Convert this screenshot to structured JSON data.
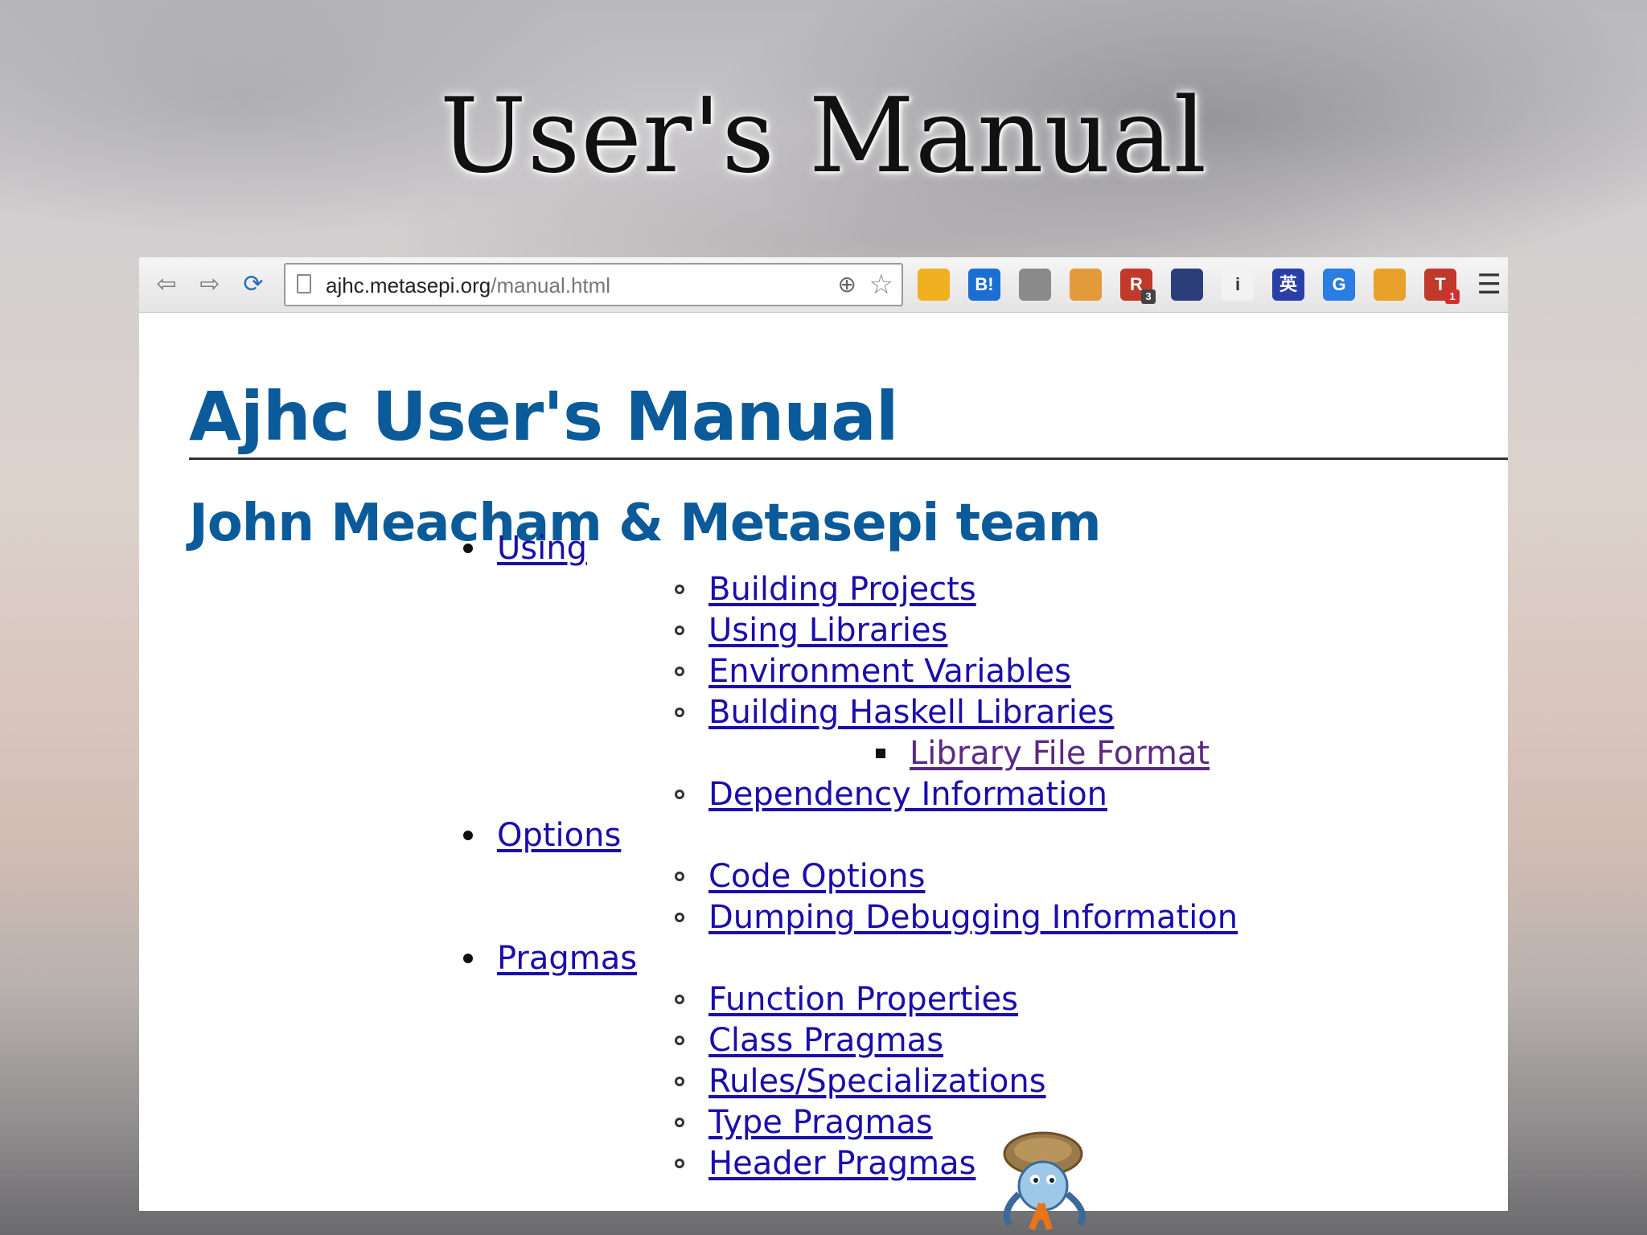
{
  "slide": {
    "title": "User's Manual"
  },
  "browser": {
    "url_host": "ajhc.metasepi.org",
    "url_path": "/manual.html",
    "nav": {
      "back_icon": "back-arrow-icon",
      "forward_icon": "forward-arrow-icon",
      "reload_icon": "reload-icon"
    },
    "extensions": [
      {
        "name": "ext-sync-icon",
        "label": "",
        "color": "#f0b020"
      },
      {
        "name": "ext-hatena-bookmark-icon",
        "label": "B!",
        "color": "#1b6fd3"
      },
      {
        "name": "ext-mail-icon",
        "label": "",
        "color": "#8a8a8a"
      },
      {
        "name": "ext-fox-icon",
        "label": "",
        "color": "#e39a3a"
      },
      {
        "name": "ext-r-icon",
        "label": "R",
        "color": "#c0392b",
        "badge": "3"
      },
      {
        "name": "ext-night-icon",
        "label": "",
        "color": "#2c3e7a"
      },
      {
        "name": "ext-info-icon",
        "label": "i",
        "color": "#f2f2f2"
      },
      {
        "name": "ext-eiji-icon",
        "label": "英",
        "color": "#2b3fa8"
      },
      {
        "name": "ext-google-icon",
        "label": "G",
        "color": "#2a7de1"
      },
      {
        "name": "ext-food-icon",
        "label": "",
        "color": "#e8a22a"
      },
      {
        "name": "ext-t-icon",
        "label": "T",
        "color": "#c0392b",
        "badge": "1"
      }
    ]
  },
  "page": {
    "title": "Ajhc User's Manual",
    "authors": "John Meacham & Metasepi team",
    "toc": [
      {
        "level": 1,
        "label": "Using"
      },
      {
        "level": 2,
        "label": "Building Projects"
      },
      {
        "level": 2,
        "label": "Using Libraries"
      },
      {
        "level": 2,
        "label": "Environment Variables"
      },
      {
        "level": 2,
        "label": "Building Haskell Libraries"
      },
      {
        "level": 3,
        "label": "Library File Format",
        "visited": true
      },
      {
        "level": 2,
        "label": "Dependency Information"
      },
      {
        "level": 1,
        "label": "Options"
      },
      {
        "level": 2,
        "label": "Code Options"
      },
      {
        "level": 2,
        "label": "Dumping Debugging Information"
      },
      {
        "level": 1,
        "label": "Pragmas"
      },
      {
        "level": 2,
        "label": "Function Properties"
      },
      {
        "level": 2,
        "label": "Class Pragmas"
      },
      {
        "level": 2,
        "label": "Rules/Specializations"
      },
      {
        "level": 2,
        "label": "Type Pragmas"
      },
      {
        "level": 2,
        "label": "Header Pragmas"
      }
    ]
  },
  "colors": {
    "heading": "#0b5a9a",
    "link": "#1a0dab",
    "visited_link": "#5b2a84"
  }
}
